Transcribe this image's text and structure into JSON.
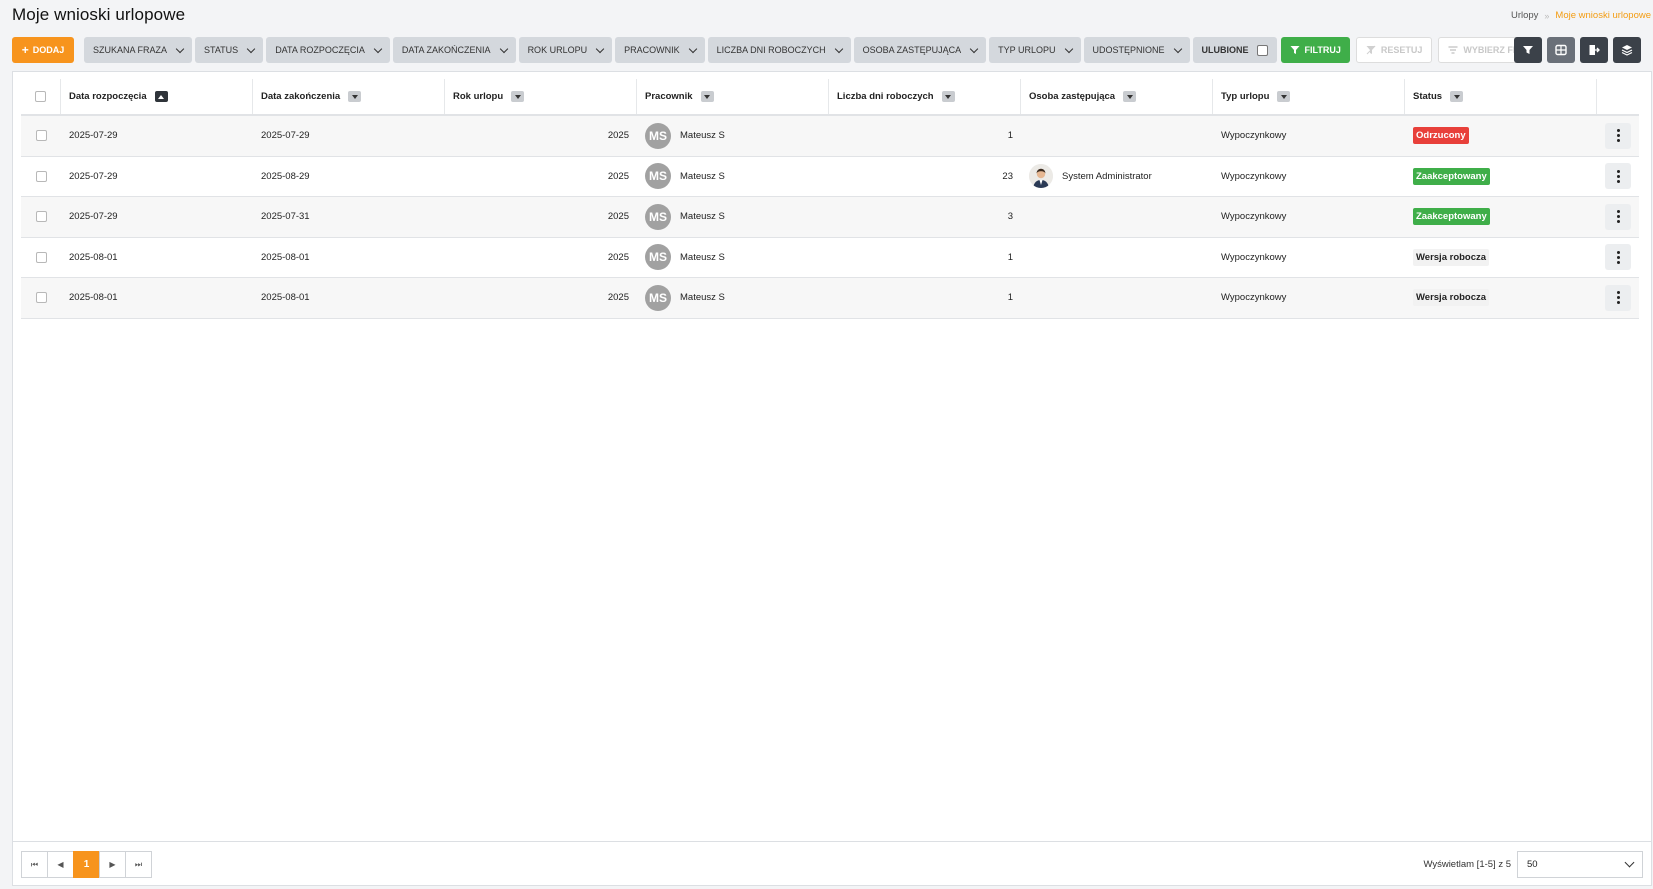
{
  "page": {
    "title": "Moje wnioski urlopowe"
  },
  "breadcrumb": {
    "parent": "Urlopy",
    "separator": "»",
    "current": "Moje wnioski urlopowe"
  },
  "toolbar": {
    "add_label": "DODAJ",
    "filters": [
      "SZUKANA FRAZA",
      "STATUS",
      "DATA ROZPOCZĘCIA",
      "DATA ZAKOŃCZENIA",
      "ROK URLOPU",
      "PRACOWNIK",
      "LICZBA DNI ROBOCZYCH",
      "OSOBA ZASTĘPUJĄCA",
      "TYP URLOPU",
      "UDOSTĘPNIONE"
    ],
    "favorites_label": "ULUBIONE",
    "filter_label": "FILTRUJ",
    "reset_label": "RESETUJ",
    "choose_filter_label": "WYBIERZ FILTR",
    "right_icons": [
      "filter-save-icon",
      "grid-icon",
      "export-icon",
      "layers-icon"
    ]
  },
  "table": {
    "columns": [
      "Data rozpoczęcia",
      "Data zakończenia",
      "Rok urlopu",
      "Pracownik",
      "Liczba dni roboczych",
      "Osoba zastępująca",
      "Typ urlopu",
      "Status"
    ],
    "rows": [
      {
        "start": "2025-07-29",
        "end": "2025-07-29",
        "year": "2025",
        "employee_initials": "MS",
        "employee": "Mateusz S",
        "days": "1",
        "substitute": "",
        "type": "Wypoczynkowy",
        "status": "Odrzucony",
        "status_kind": "rejected"
      },
      {
        "start": "2025-07-29",
        "end": "2025-08-29",
        "year": "2025",
        "employee_initials": "MS",
        "employee": "Mateusz S",
        "days": "23",
        "substitute": "System Administrator",
        "type": "Wypoczynkowy",
        "status": "Zaakceptowany",
        "status_kind": "accepted"
      },
      {
        "start": "2025-07-29",
        "end": "2025-07-31",
        "year": "2025",
        "employee_initials": "MS",
        "employee": "Mateusz S",
        "days": "3",
        "substitute": "",
        "type": "Wypoczynkowy",
        "status": "Zaakceptowany",
        "status_kind": "accepted"
      },
      {
        "start": "2025-08-01",
        "end": "2025-08-01",
        "year": "2025",
        "employee_initials": "MS",
        "employee": "Mateusz S",
        "days": "1",
        "substitute": "",
        "type": "Wypoczynkowy",
        "status": "Wersja robocza",
        "status_kind": "draft"
      },
      {
        "start": "2025-08-01",
        "end": "2025-08-01",
        "year": "2025",
        "employee_initials": "MS",
        "employee": "Mateusz S",
        "days": "1",
        "substitute": "",
        "type": "Wypoczynkowy",
        "status": "Wersja robocza",
        "status_kind": "draft"
      }
    ]
  },
  "pagination": {
    "first": "⏮",
    "prev": "◀",
    "current_page": "1",
    "next": "▶",
    "last": "⏭",
    "info": "Wyświetlam [1-5] z 5",
    "per_page": "50"
  },
  "colors": {
    "accent": "#f7941d",
    "success": "#3fae49",
    "danger": "#e8403a",
    "dark": "#3b4149"
  }
}
